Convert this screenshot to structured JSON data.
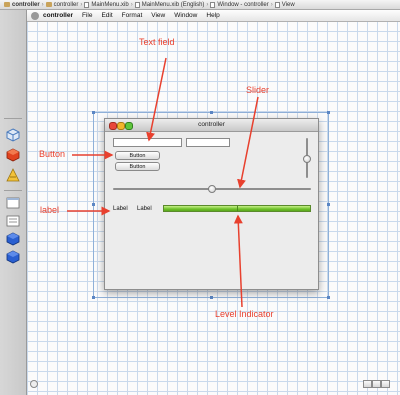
{
  "jumpbar": {
    "items": [
      "controller",
      "controller",
      "MainMenu.xib",
      "MainMenu.xib (English)",
      "Window - controller",
      "View"
    ]
  },
  "menubar": {
    "app": "controller",
    "items": [
      "File",
      "Edit",
      "Format",
      "View",
      "Window",
      "Help"
    ]
  },
  "window": {
    "title": "controller",
    "buttons": [
      "Button",
      "Button"
    ],
    "labels": [
      "Label",
      "Label"
    ]
  },
  "annotations": {
    "text_field": "Text field",
    "slider": "Slider",
    "button": "Button",
    "label": "label",
    "level_indicator": "Level Indicator"
  },
  "controls": {
    "horizontal_slider_value": 0.5,
    "vertical_slider_value": 0.5,
    "level_indicator_fill": 1.0
  },
  "colors": {
    "annotation": "#e8402e",
    "level": "#6fc22a",
    "grid": "#c9d9ec",
    "selection": "#8fb0d8"
  },
  "icons": {
    "traffic_lights": [
      "close-icon",
      "minimize-icon",
      "zoom-icon"
    ],
    "dock": [
      "object-cube-icon",
      "red-cube-icon",
      "app-icon",
      "window-icon",
      "blue-cube-icon",
      "blue-cube-icon"
    ]
  }
}
